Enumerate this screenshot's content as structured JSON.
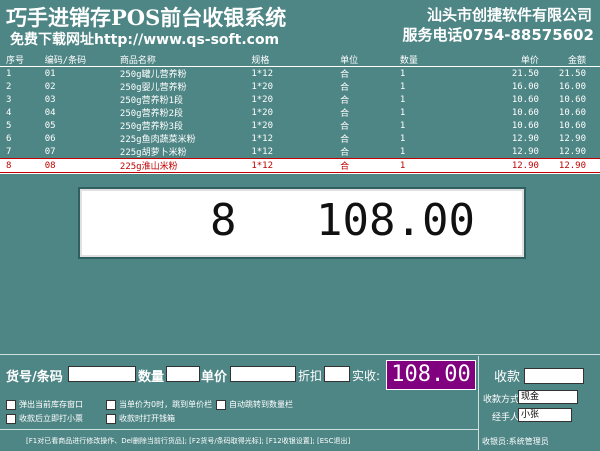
{
  "header": {
    "title": "巧手进销存POS前台收银系统",
    "download": "免费下载网址http://www.qs-soft.com",
    "company": "汕头市创捷软件有限公司",
    "phone": "服务电话0754-88575602"
  },
  "table": {
    "columns": [
      "序号",
      "编码/条码",
      "商品名称",
      "规格",
      "单位",
      "数量",
      "单价",
      "金额"
    ],
    "rows": [
      [
        "1",
        "01",
        "250g罐儿营养粉",
        "1*12",
        "合",
        "1",
        "21.50",
        "21.50"
      ],
      [
        "2",
        "02",
        "250g婴儿营养粉",
        "1*20",
        "合",
        "1",
        "16.00",
        "16.00"
      ],
      [
        "3",
        "03",
        "250g营养粉1段",
        "1*20",
        "合",
        "1",
        "10.60",
        "10.60"
      ],
      [
        "4",
        "04",
        "250g营养粉2段",
        "1*20",
        "合",
        "1",
        "10.60",
        "10.60"
      ],
      [
        "5",
        "05",
        "250g营养粉3段",
        "1*20",
        "合",
        "1",
        "10.60",
        "10.60"
      ],
      [
        "6",
        "06",
        "225g鱼肉蔬菜米粉",
        "1*12",
        "合",
        "1",
        "12.90",
        "12.90"
      ],
      [
        "7",
        "07",
        "225g胡萝卜米粉",
        "1*12",
        "合",
        "1",
        "12.90",
        "12.90"
      ],
      [
        "8",
        "08",
        "225g淮山米粉",
        "1*12",
        "合",
        "1",
        "12.90",
        "12.90"
      ]
    ],
    "selected_row": 7
  },
  "display": {
    "quantity": "8",
    "total": "108.00"
  },
  "entry": {
    "barcode_label": "货号/条码",
    "qty_label": "数量",
    "price_label": "单价",
    "discount_label": "折扣",
    "paid_label": "实收:",
    "paid_value": "108.00"
  },
  "options": [
    "弹出当前库存窗口",
    "当单价为0时，跳到单价栏",
    "自动跳转到数量栏",
    "收款后立即打小票",
    "收款时打开钱箱"
  ],
  "payment": {
    "receive_label": "收款",
    "method_label": "收款方式",
    "method_value": "现金",
    "handler_label": "经手人",
    "handler_value": "小张"
  },
  "footer": {
    "hint": "[F1对已看商品进行修改操作、Del删除当前行货品]; [F2货号/条码取得光标]; [F12收银设置]; [ESC退出]",
    "cashier": "收银员:系统管理员"
  }
}
